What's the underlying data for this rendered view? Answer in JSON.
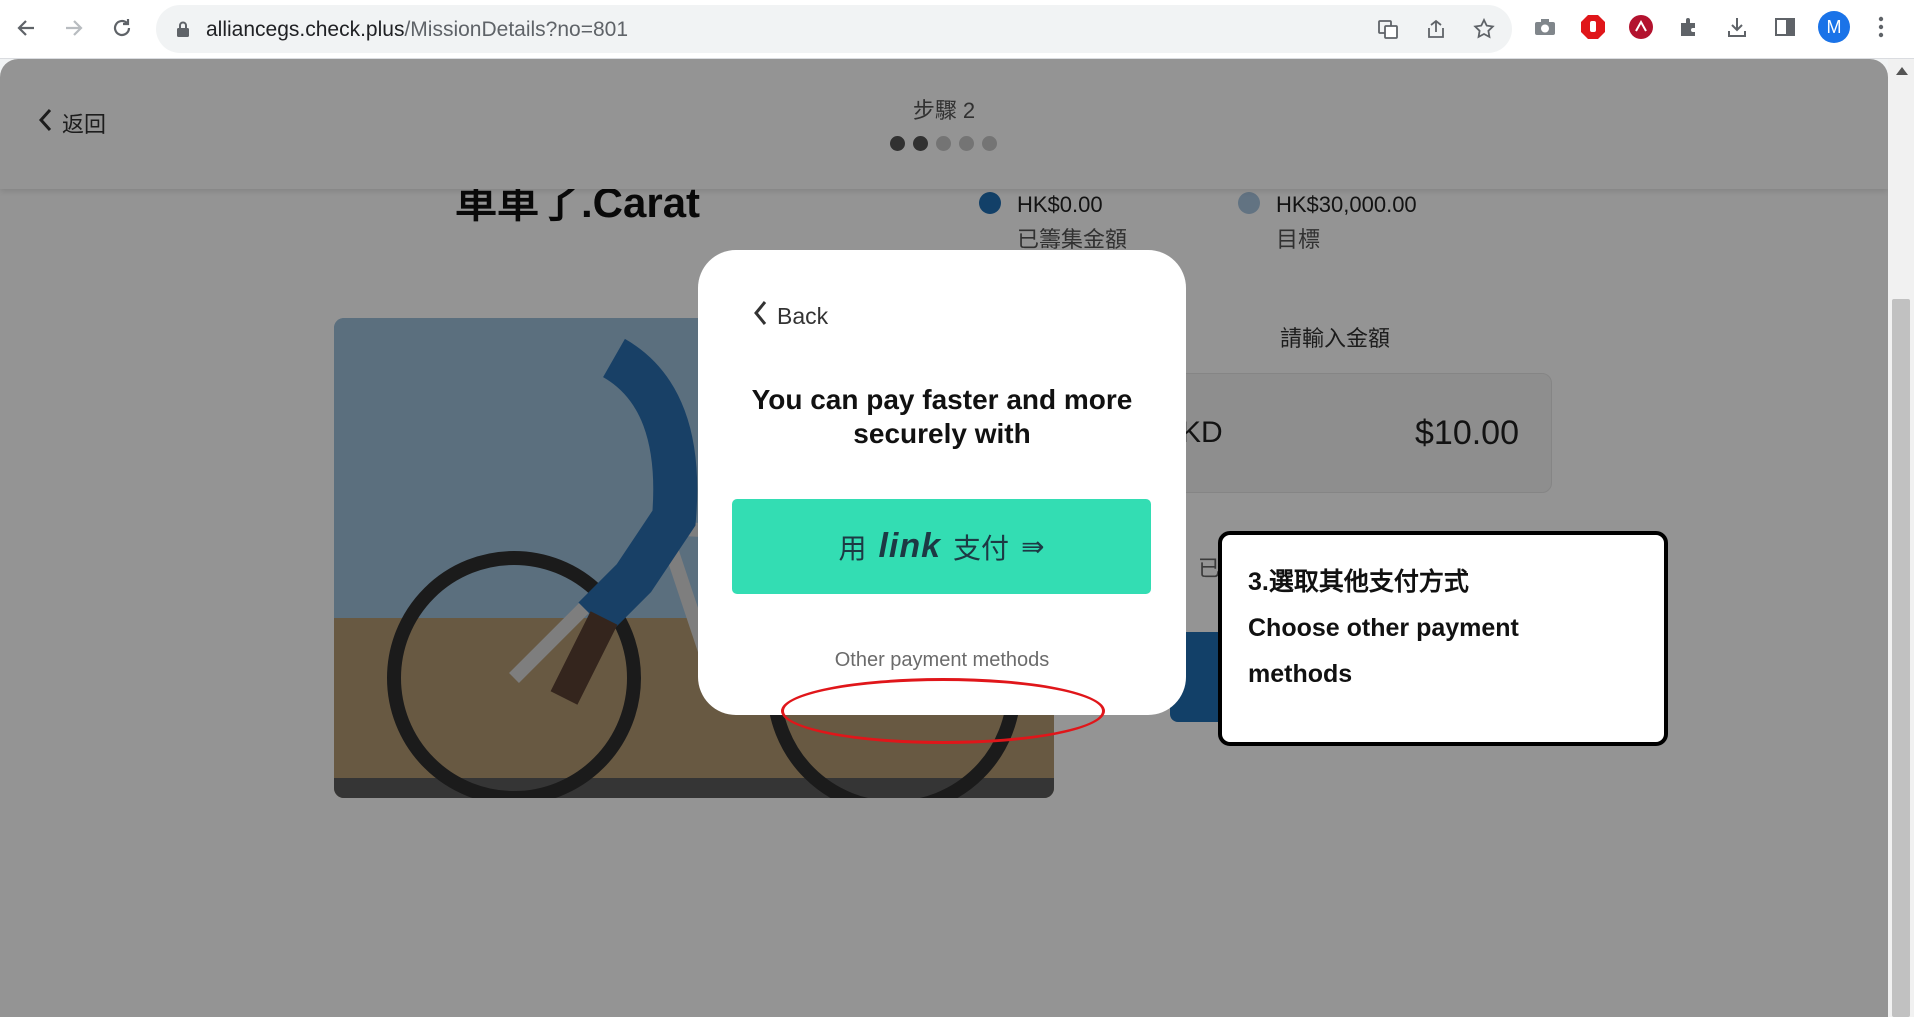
{
  "browser": {
    "url_host": "alliancegs.check.plus",
    "url_path": "/MissionDetails?no=801",
    "profile_initial": "M"
  },
  "header": {
    "back_label": "返回",
    "step_label": "步驟 2",
    "steps_total": 5,
    "steps_completed": 2
  },
  "campaign": {
    "title": "車車了.Carat",
    "raised_amount": "HK$0.00",
    "raised_caption": "已籌集金額",
    "target_amount": "HK$30,000.00",
    "target_caption": "目標"
  },
  "donation": {
    "prompt": "請輸入金額",
    "currency_fragment": "KD",
    "amount_value": "$10.00",
    "partial_text": "已"
  },
  "modal": {
    "back_label": "Back",
    "heading": "You can pay faster and more securely with",
    "link_button": {
      "prefix": "用",
      "brand": "link",
      "suffix": "支付",
      "arrow": "⇛"
    },
    "other_methods_label": "Other payment methods"
  },
  "callout": {
    "line1": "3.選取其他支付方式",
    "line2": "Choose other payment",
    "line3": "methods"
  },
  "colors": {
    "link_green": "#33ddb3",
    "highlight_red": "#e0161a",
    "raised_bullet": "#1f6fb3",
    "target_bullet": "#a9c6e0"
  }
}
